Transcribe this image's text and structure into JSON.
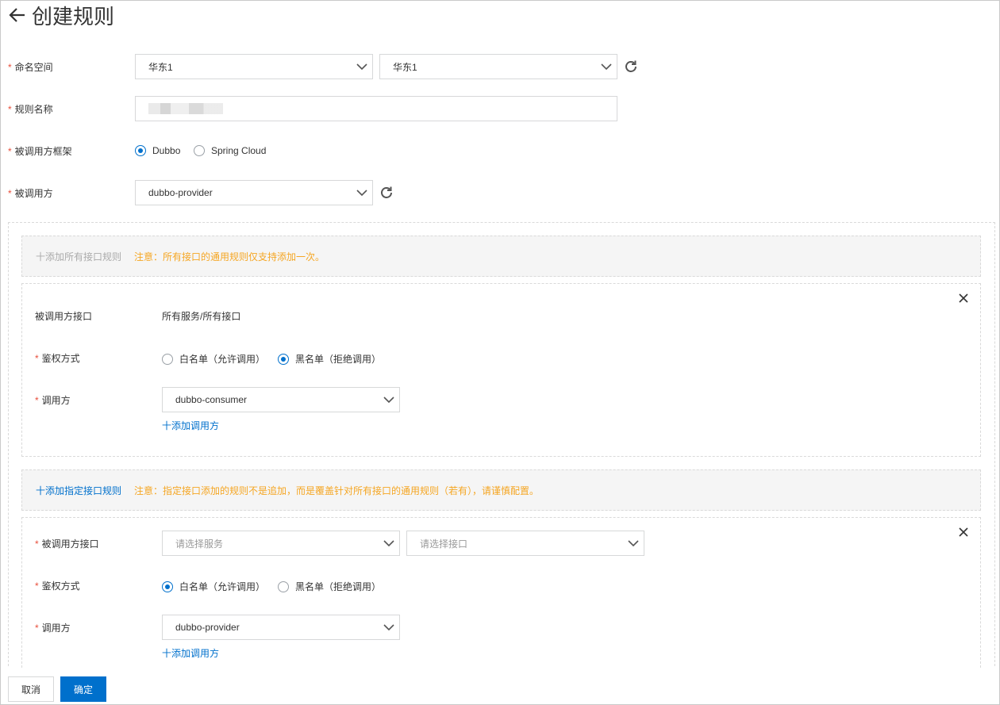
{
  "page": {
    "title": "创建规则"
  },
  "form": {
    "namespace": {
      "label": "命名空间",
      "region": "华东1",
      "namespace": "华东1"
    },
    "rule_name": {
      "label": "规则名称"
    },
    "framework": {
      "label": "被调用方框架",
      "options": [
        "Dubbo",
        "Spring Cloud"
      ],
      "selected": "Dubbo"
    },
    "callee": {
      "label": "被调用方",
      "value": "dubbo-provider"
    }
  },
  "all_interfaces_band": {
    "add_label": "十添加所有接口规则",
    "note": "注意：所有接口的通用规则仅支持添加一次。"
  },
  "rule_card_1": {
    "interface_label": "被调用方接口",
    "interface_value": "所有服务/所有接口",
    "auth_label": "鉴权方式",
    "auth_options": [
      "白名单（允许调用）",
      "黑名单（拒绝调用）"
    ],
    "auth_selected": "黑名单（拒绝调用）",
    "caller_label": "调用方",
    "caller_value": "dubbo-consumer",
    "add_caller": "十添加调用方"
  },
  "specific_band": {
    "add_label": "十添加指定接口规则",
    "note": "注意：指定接口添加的规则不是追加，而是覆盖针对所有接口的通用规则（若有），请谨慎配置。"
  },
  "rule_card_2": {
    "interface_label": "被调用方接口",
    "service_placeholder": "请选择服务",
    "interface_placeholder": "请选择接口",
    "auth_label": "鉴权方式",
    "auth_options": [
      "白名单（允许调用）",
      "黑名单（拒绝调用）"
    ],
    "auth_selected": "白名单（允许调用）",
    "caller_label": "调用方",
    "caller_value": "dubbo-provider",
    "add_caller": "十添加调用方"
  },
  "footer": {
    "cancel": "取消",
    "confirm": "确定"
  },
  "colors": {
    "primary": "#0070cc",
    "required": "#e84f3c",
    "warning": "#f5a623",
    "band_bg": "#f5f5f5"
  },
  "icons": {
    "back": "arrow-left-icon",
    "refresh": "refresh-icon",
    "dropdown": "chevron-down-icon",
    "close": "close-icon"
  }
}
